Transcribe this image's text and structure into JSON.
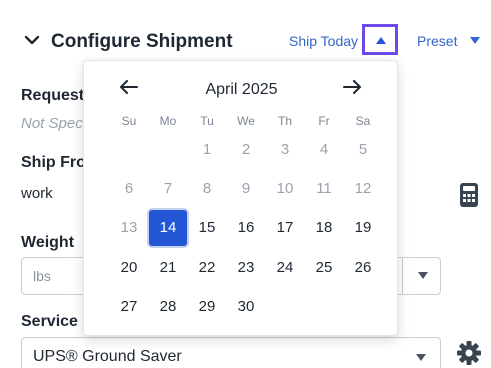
{
  "header": {
    "title": "Configure Shipment",
    "ship_today_label": "Ship Today",
    "preset_label": "Preset"
  },
  "fields": {
    "request_label": "Request",
    "request_value": "Not Spec",
    "ship_from_label": "Ship Fro",
    "ship_from_value": "work",
    "weight_label": "Weight",
    "weight_unit": "lbs",
    "service_label": "Service",
    "service_value": "UPS® Ground Saver"
  },
  "calendar": {
    "month_label": "April 2025",
    "prev_icon": "arrow-left-icon",
    "next_icon": "arrow-right-icon",
    "weekdays": [
      "Su",
      "Mo",
      "Tu",
      "We",
      "Th",
      "Fr",
      "Sa"
    ],
    "selected_day": "14",
    "weeks": [
      [
        "",
        "",
        "1",
        "2",
        "3",
        "4",
        "5"
      ],
      [
        "6",
        "7",
        "8",
        "9",
        "10",
        "11",
        "12"
      ],
      [
        "13",
        "14",
        "15",
        "16",
        "17",
        "18",
        "19"
      ],
      [
        "20",
        "21",
        "22",
        "23",
        "24",
        "25",
        "26"
      ],
      [
        "27",
        "28",
        "29",
        "30",
        "",
        "",
        ""
      ]
    ],
    "disabled_days": [
      "1",
      "2",
      "3",
      "4",
      "5",
      "6",
      "7",
      "8",
      "9",
      "10",
      "11",
      "12",
      "13"
    ]
  },
  "colors": {
    "accent": "#2457d6",
    "link": "#3366cc",
    "focus_outline": "#6c4be8"
  }
}
